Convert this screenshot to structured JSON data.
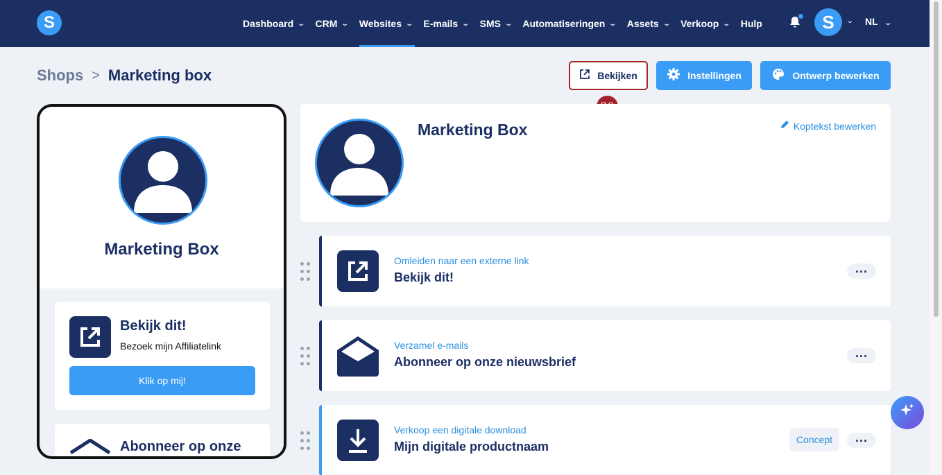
{
  "logo": {
    "letter": "S"
  },
  "nav": {
    "items": [
      {
        "label": "Dashboard",
        "chevron": true
      },
      {
        "label": "CRM",
        "chevron": true
      },
      {
        "label": "Websites",
        "chevron": true,
        "active": true
      },
      {
        "label": "E-mails",
        "chevron": true
      },
      {
        "label": "SMS",
        "chevron": true
      },
      {
        "label": "Automatiseringen",
        "chevron": true
      },
      {
        "label": "Assets",
        "chevron": true
      },
      {
        "label": "Verkoop",
        "chevron": true
      },
      {
        "label": "Hulp",
        "chevron": false
      }
    ],
    "user_initial": "S",
    "language": "NL"
  },
  "breadcrumb": {
    "parent": "Shops",
    "current": "Marketing box"
  },
  "actions": {
    "view_label": "Bekijken",
    "settings_label": "Instellingen",
    "design_label": "Ontwerp bewerken",
    "annotation_number": "30"
  },
  "preview": {
    "title": "Marketing Box",
    "card1": {
      "title": "Bekijk dit!",
      "subtitle": "Bezoek mijn Affiliatelink",
      "button": "Klik op mij!"
    },
    "card2": {
      "title": "Abonneer op onze"
    }
  },
  "header_card": {
    "title": "Marketing Box",
    "edit_label": "Koptekst bewerken"
  },
  "blocks": [
    {
      "type": "Omleiden naar een externe link",
      "title": "Bekijk dit!",
      "icon": "external-link-icon"
    },
    {
      "type": "Verzamel e-mails",
      "title": "Abonneer op onze nieuwsbrief",
      "icon": "envelope-icon"
    },
    {
      "type": "Verkoop een digitale download",
      "title": "Mijn digitale productnaam",
      "icon": "download-icon",
      "status": "Concept"
    }
  ],
  "colors": {
    "navy": "#1b2f63",
    "accent": "#3b9cf5",
    "highlight": "#a5232b"
  }
}
